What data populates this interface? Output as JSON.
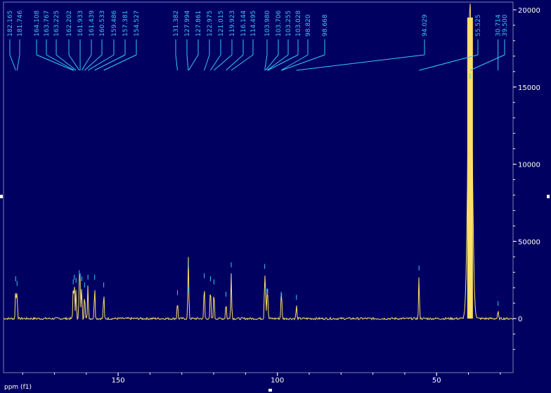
{
  "chart_data": {
    "type": "line",
    "title": "",
    "xlabel": "ppm (f1)",
    "ylabel": "",
    "xlim": [
      186,
      26
    ],
    "ylim": [
      -3500,
      20500
    ],
    "x_ticks": [
      150,
      100,
      50
    ],
    "x_tick_labels": [
      "150",
      "100",
      "50"
    ],
    "y_ticks": [
      0,
      5000,
      10000,
      15000,
      20000
    ],
    "y_tick_labels": [
      "0",
      "50000",
      "10000",
      "15000",
      "20000"
    ],
    "grid": false,
    "colors": {
      "background": "#000060",
      "spectrum": "#ffe066",
      "peak_label": "#39c6ff",
      "axis": "#ffffff"
    },
    "series": [
      {
        "peaks": [
          {
            "ppm": 182.165,
            "label": "182.165",
            "height": 2100
          },
          {
            "ppm": 181.746,
            "label": "181.746",
            "height": 1800
          },
          {
            "ppm": 164.108,
            "label": "164.108",
            "height": 1900
          },
          {
            "ppm": 163.767,
            "label": "163.767",
            "height": 2200
          },
          {
            "ppm": 163.225,
            "label": "163.225",
            "height": 2000
          },
          {
            "ppm": 162.202,
            "label": "162.202",
            "height": 2500
          },
          {
            "ppm": 161.933,
            "label": "161.933",
            "height": 2300
          },
          {
            "ppm": 161.439,
            "label": "161.439",
            "height": 2100
          },
          {
            "ppm": 160.533,
            "label": "160.533",
            "height": 1700
          },
          {
            "ppm": 159.486,
            "label": "159.486",
            "height": 2200
          },
          {
            "ppm": 157.381,
            "label": "157.381",
            "height": 2200
          },
          {
            "ppm": 154.527,
            "label": "154.527",
            "height": 1700
          },
          {
            "ppm": 131.382,
            "label": "131.382",
            "height": 1200
          },
          {
            "ppm": 127.994,
            "label": "127.994",
            "height": 3000
          },
          {
            "ppm": 127.861,
            "label": "127.861",
            "height": 1400
          },
          {
            "ppm": 122.975,
            "label": "122.975",
            "height": 2300
          },
          {
            "ppm": 121.015,
            "label": "121.015",
            "height": 2100
          },
          {
            "ppm": 119.923,
            "label": "119.923",
            "height": 1900
          },
          {
            "ppm": 116.144,
            "label": "116.144",
            "height": 1100
          },
          {
            "ppm": 114.495,
            "label": "114.495",
            "height": 3000
          },
          {
            "ppm": 103.98,
            "label": "103.980",
            "height": 2900
          },
          {
            "ppm": 103.706,
            "label": "103.706",
            "height": 1400
          },
          {
            "ppm": 103.255,
            "label": "103.255",
            "height": 1300
          },
          {
            "ppm": 103.028,
            "label": "103.028",
            "height": 1300
          },
          {
            "ppm": 98.82,
            "label": "98.820",
            "height": 1100
          },
          {
            "ppm": 98.668,
            "label": "98.668",
            "height": 1000
          },
          {
            "ppm": 94.029,
            "label": "94.029",
            "height": 900
          },
          {
            "ppm": 55.525,
            "label": "55.525",
            "height": 2800
          },
          {
            "ppm": 39.5,
            "label": "39.500",
            "height": 20500
          },
          {
            "ppm": 30.714,
            "label": "30.714",
            "height": 500
          }
        ]
      }
    ]
  }
}
